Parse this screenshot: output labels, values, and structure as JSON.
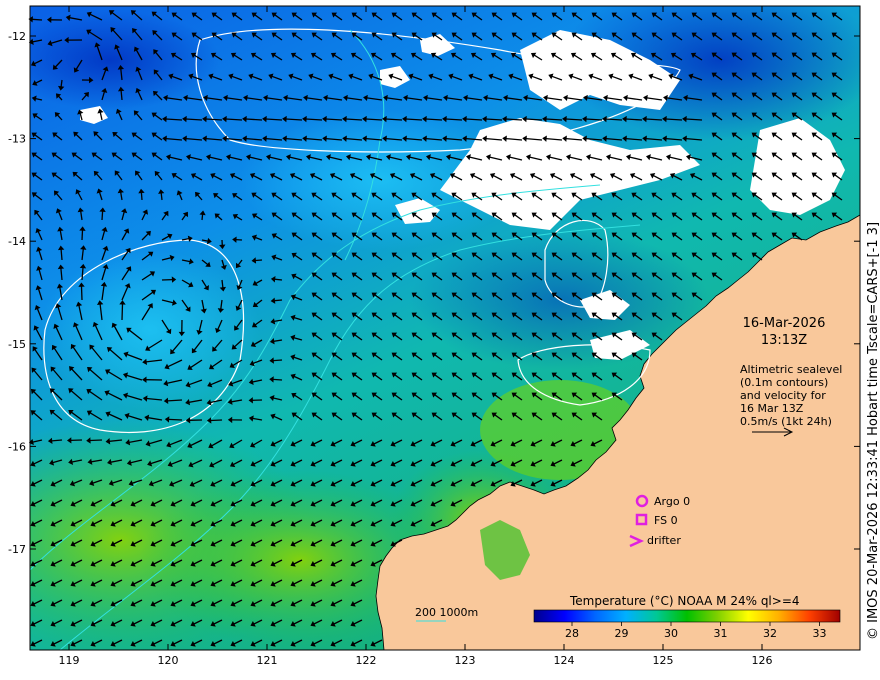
{
  "map": {
    "date": "16-Mar-2026",
    "time": "13:13Z",
    "info_lines": [
      "Altimetric sealevel",
      "(0.1m contours)",
      "and velocity for",
      "16 Mar 13Z",
      "0.5m/s (1kt 24h)"
    ],
    "lat_ticks": [
      "-12",
      "-13",
      "-14",
      "-15",
      "-16",
      "-17"
    ],
    "lon_ticks": [
      "119",
      "120",
      "121",
      "122",
      "123",
      "124",
      "125",
      "126"
    ],
    "legend": {
      "argo": "Argo 0",
      "fs": "FS 0",
      "drifter": "drifter"
    },
    "depth_legend": "200  1000m",
    "colorbar": {
      "title": "Temperature (°C) NOAA  M 24% ql>=4",
      "ticks": [
        "28",
        "29",
        "30",
        "31",
        "32",
        "33"
      ],
      "colors": [
        "#00008b",
        "#0000ff",
        "#0066ff",
        "#00b0ff",
        "#00c896",
        "#00c000",
        "#80d000",
        "#ffff00",
        "#ffb000",
        "#ff4000",
        "#a00000"
      ]
    },
    "credit": "© IMOS 20-Mar-2026 12:33:41 Hobart time Tscale=CARS+[-1 3]",
    "colors": {
      "land": "#f9c89b",
      "cloud": "#ffffff",
      "contour": "#ffffff",
      "isobath": "#33e0e0",
      "marker": "#e020e0",
      "arrow": "#000000"
    }
  }
}
